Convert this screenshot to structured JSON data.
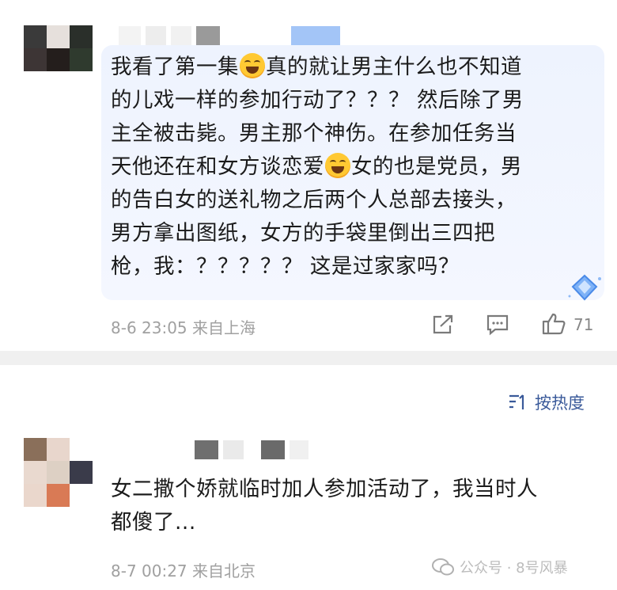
{
  "comments": [
    {
      "lines": [
        [
          "我看了第一集",
          "EMOJI",
          "真的就让男主什么也不知道"
        ],
        [
          "的儿戏一样的参加行动了？？？ 然后除了男"
        ],
        [
          "主全被击毙。男主那个神伤。在参加任务当"
        ],
        [
          "天他还在和女方谈恋爱",
          "EMOJI",
          "女的也是党员，男"
        ],
        [
          "的告白女的送礼物之后两个人总部去接头，"
        ],
        [
          "男方拿出图纸，女方的手袋里倒出三四把"
        ],
        [
          "枪，我：？？？？？ 这是过家家吗？"
        ]
      ],
      "date": "8-6 23:05",
      "location": "来自上海",
      "likes": "71"
    },
    {
      "lines": [
        [
          "女二撒个娇就临时加人参加活动了，我当时人"
        ],
        [
          "都傻了..."
        ]
      ],
      "date": "8-7 00:27",
      "location": "来自北京"
    }
  ],
  "sort_label": "按热度",
  "watermark": "公众号 · 8号风暴",
  "colors": {
    "bubble": "#eef3fe",
    "meta": "#a0a0a0",
    "sort": "#3a5a9a"
  },
  "icons": [
    "share-icon",
    "comment-icon",
    "like-icon",
    "sort-icon",
    "diamond-badge-icon"
  ]
}
